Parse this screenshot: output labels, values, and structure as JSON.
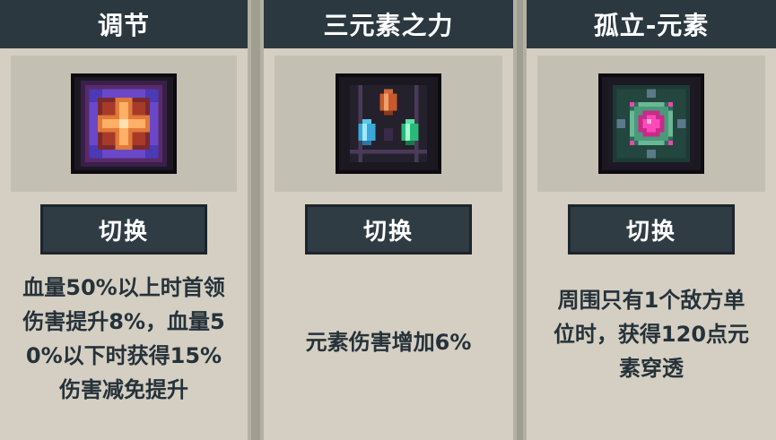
{
  "cards": [
    {
      "title": "调节",
      "icon": "regulation-icon",
      "button_label": "切换",
      "description_lines": [
        "血量50%以上时首领",
        "伤害提升8%，血量5",
        "0%以下时获得15%",
        "伤害减免提升"
      ]
    },
    {
      "title": "三元素之力",
      "icon": "three-elements-icon",
      "button_label": "切换",
      "description_lines": [
        "元素伤害增加6%"
      ]
    },
    {
      "title": "孤立-元素",
      "icon": "isolation-element-icon",
      "button_label": "切换",
      "description_lines": [
        "周围只有1个敌方单",
        "位时，获得120点元",
        "素穿透"
      ]
    }
  ],
  "colors": {
    "title_bar": "#2b3840",
    "card_bg": "#d4cfc2",
    "button_bg": "#2f3c44",
    "text": "#26323a"
  }
}
